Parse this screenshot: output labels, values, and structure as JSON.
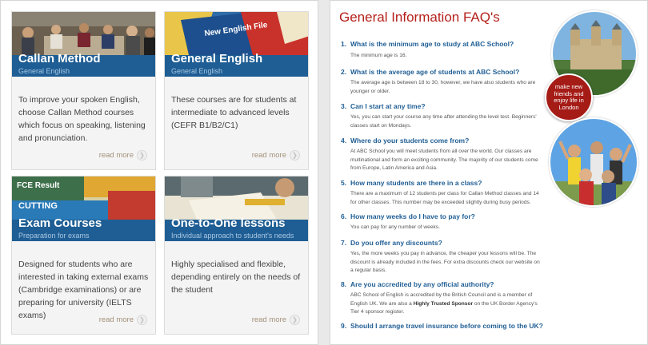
{
  "courses": [
    {
      "title": "Callan Method",
      "subtitle": "General English",
      "description": "To improve your spoken English, choose Callan Method courses which focus on speaking, listening and pronunciation.",
      "link": "read more"
    },
    {
      "title": "General English",
      "subtitle": "General English",
      "description": "These courses are for students at intermediate to advanced levels (CEFR B1/B2/C1)",
      "link": "read more"
    },
    {
      "title": "Exam Courses",
      "subtitle": "Preparation for exams",
      "description": "Designed for students who are interested in taking external exams (Cambridge examinations) or are preparing for university (IELTS exams)",
      "link": "read more"
    },
    {
      "title": "One-to-One lessons",
      "subtitle": "Individual approach to student's needs",
      "description": "Highly specialised and flexible, depending entirely on the needs of the student",
      "link": "read more"
    }
  ],
  "image_text": {
    "book1": "New English File",
    "book2": "FCE Result",
    "book3": "CUTTING"
  },
  "faq": {
    "title": "General Information FAQ's",
    "badge": "make new friends and enjoy life in London",
    "items": [
      {
        "num": "1.",
        "q": "What is the minimum age to study at ABC School?",
        "a": "The minimum age is 16."
      },
      {
        "num": "2.",
        "q": "What is the average age of students at ABC School?",
        "a": "The average age is between 18 to 30, however, we have also students who are younger or older."
      },
      {
        "num": "3.",
        "q": "Can I start at any time?",
        "a": "Yes, you can start your course any time after attending the level test. Beginners' classes start on Mondays."
      },
      {
        "num": "4.",
        "q": "Where do your students come from?",
        "a": "At ABC School you will meet students from all over the world.  Our classes are multinational and form an exciting community.  The majority of our students come from Europe, Latin America and Asia."
      },
      {
        "num": "5.",
        "q": "How many students are there in a class?",
        "a": "There are a maximum of 12 students per class for Callan Method classes and 14 for other classes. This number may be exceeded slightly during busy periods."
      },
      {
        "num": "6.",
        "q": "How many weeks do I have to pay for?",
        "a": "You can pay for any number of weeks."
      },
      {
        "num": "7.",
        "q": "Do you offer any discounts?",
        "a": "Yes, the more weeks you pay in advance, the cheaper your lessons will be. The discount is already included in the fees.  For extra discounts check our website on a regular basis."
      },
      {
        "num": "8.",
        "q": "Are you accredited by any official authority?",
        "a_pre": "ABC School of English is accredited by the British Council and is a member of English UK.  We are also a ",
        "a_bold": "Highly Trusted Sponsor",
        "a_post": " on the UK Border Agency's Tier 4 sponsor register."
      },
      {
        "num": "9.",
        "q": "Should I arrange travel insurance before coming to the UK?"
      }
    ]
  },
  "colors": {
    "accent": "#b5211b",
    "brand_blue": "#1f5e94",
    "link": "#a3917a"
  }
}
